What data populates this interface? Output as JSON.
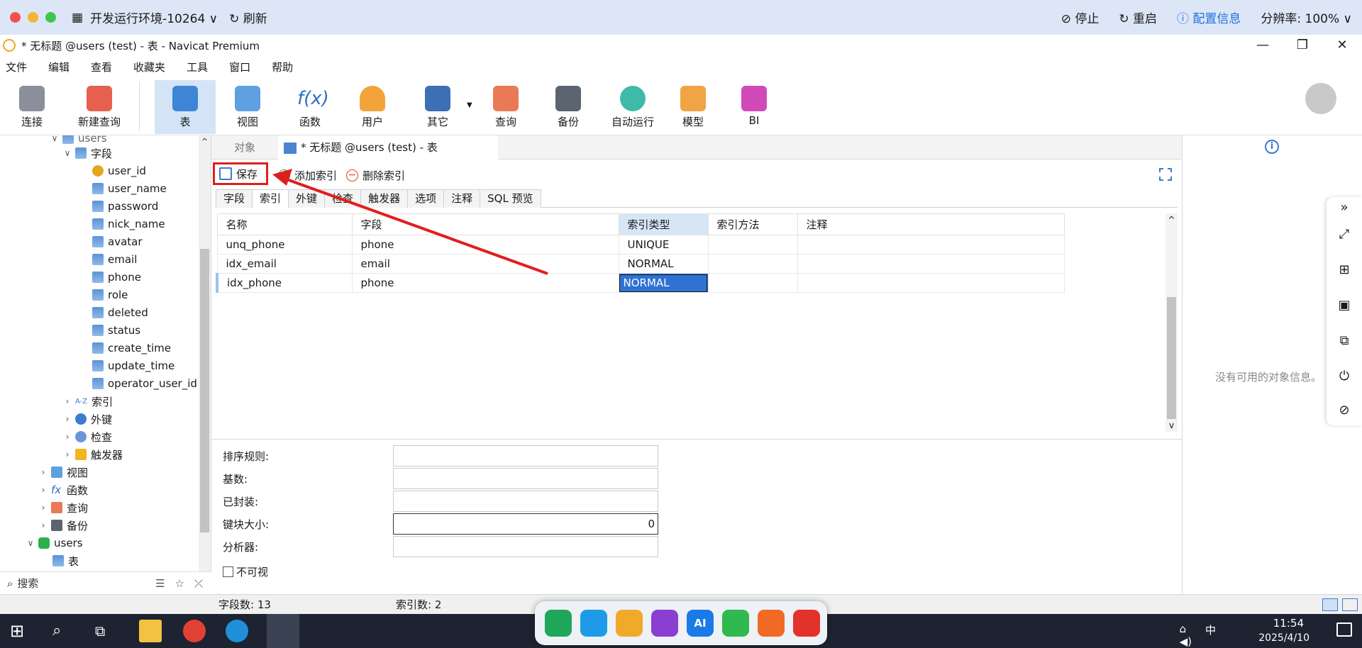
{
  "remote_bar": {
    "env_title": "开发运行环境-10264",
    "refresh_label": "刷新",
    "stop_label": "停止",
    "restart_label": "重启",
    "config_label": "配置信息",
    "resolution_label": "分辨率: 100%"
  },
  "window": {
    "title": "* 无标题 @users (test) - 表 - Navicat Premium"
  },
  "menu": [
    "文件",
    "编辑",
    "查看",
    "收藏夹",
    "工具",
    "窗口",
    "帮助"
  ],
  "toolbar": {
    "buttons": [
      {
        "label": "连接",
        "icon": "plug-icon"
      },
      {
        "label": "新建查询",
        "icon": "new-query-icon"
      },
      {
        "label": "表",
        "icon": "table-icon",
        "active": true
      },
      {
        "label": "视图",
        "icon": "view-icon"
      },
      {
        "label": "函数",
        "icon": "function-icon"
      },
      {
        "label": "用户",
        "icon": "user-icon"
      },
      {
        "label": "其它",
        "icon": "tools-icon"
      },
      {
        "label": "查询",
        "icon": "query-icon"
      },
      {
        "label": "备份",
        "icon": "backup-icon"
      },
      {
        "label": "自动运行",
        "icon": "robot-icon"
      },
      {
        "label": "模型",
        "icon": "model-icon"
      },
      {
        "label": "BI",
        "icon": "bi-icon"
      }
    ]
  },
  "sidebar": {
    "top_partial": "users",
    "fields_label": "字段",
    "fields": [
      "user_id",
      "user_name",
      "password",
      "nick_name",
      "avatar",
      "email",
      "phone",
      "role",
      "deleted",
      "status",
      "create_time",
      "update_time",
      "operator_user_id"
    ],
    "table_children": [
      {
        "label": "索引",
        "icon": "az-sort-icon"
      },
      {
        "label": "外键",
        "icon": "link-icon"
      },
      {
        "label": "检查",
        "icon": "check-icon"
      },
      {
        "label": "触发器",
        "icon": "lightning-icon"
      }
    ],
    "db_children": [
      {
        "label": "视图",
        "icon": "view-icon"
      },
      {
        "label": "函数",
        "icon": "function-icon"
      },
      {
        "label": "查询",
        "icon": "query-icon"
      },
      {
        "label": "备份",
        "icon": "backup-icon"
      }
    ],
    "db2": {
      "label": "users",
      "child": "表"
    },
    "search_placeholder": "搜索"
  },
  "main": {
    "tab_objects": "对象",
    "tab_doc": "* 无标题 @users (test) - 表",
    "save_label": "保存",
    "add_index_label": "添加索引",
    "delete_index_label": "删除索引",
    "sub_tabs": [
      "字段",
      "索引",
      "外键",
      "检查",
      "触发器",
      "选项",
      "注释",
      "SQL 预览"
    ],
    "grid": {
      "columns": [
        "名称",
        "字段",
        "索引类型",
        "索引方法",
        "注释"
      ],
      "rows": [
        {
          "name": "unq_phone",
          "field": "phone",
          "type": "UNIQUE",
          "method": "",
          "comment": ""
        },
        {
          "name": "idx_email",
          "field": "email",
          "type": "NORMAL",
          "method": "",
          "comment": ""
        },
        {
          "name": "idx_phone",
          "field": "phone",
          "type": "NORMAL",
          "method": "",
          "comment": ""
        }
      ]
    },
    "props": {
      "collation_label": "排序规则:",
      "cardinality_label": "基数:",
      "packed_label": "已封装:",
      "key_block_label": "键块大小:",
      "key_block_value": "0",
      "parser_label": "分析器:",
      "invisible_label": "不可视"
    }
  },
  "info_panel": {
    "empty_text": "没有可用的对象信息。"
  },
  "status": {
    "field_count": "字段数: 13",
    "index_count": "索引数: 2"
  },
  "taskbar": {
    "time": "11:54",
    "date": "2025/4/10",
    "ime": "中"
  },
  "colors": {
    "accent": "#2f72d3",
    "highlight_box": "#e01e1e",
    "remote_bar_bg": "#dde6f6",
    "taskbar_bg": "#1d2331"
  }
}
